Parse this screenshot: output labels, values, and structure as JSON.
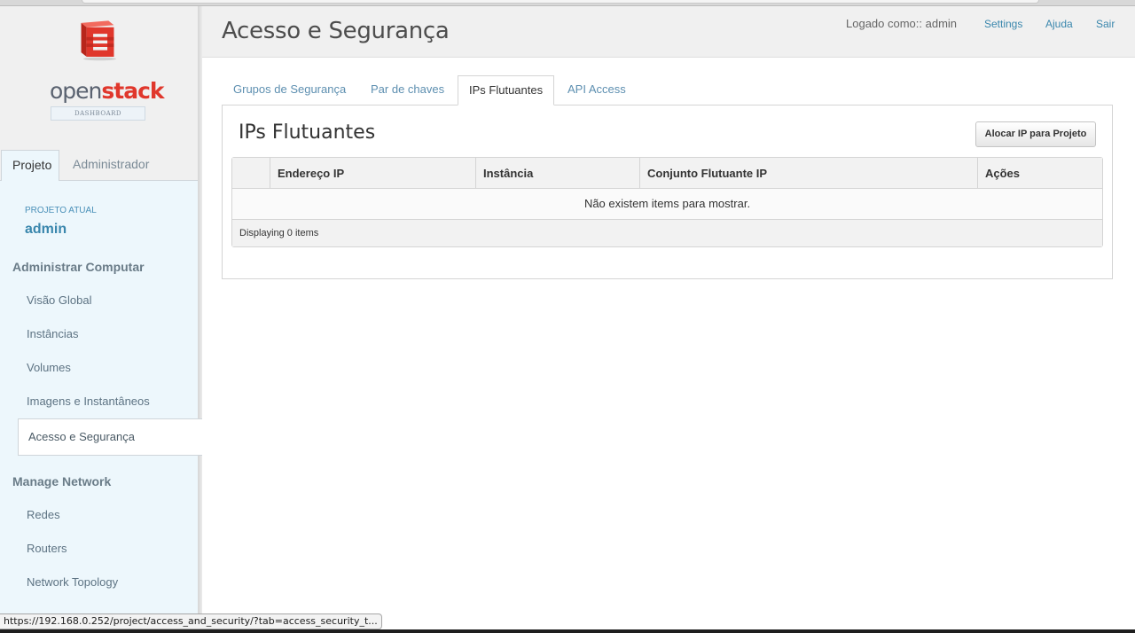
{
  "brand": {
    "open": "open",
    "stack": "stack",
    "badge": "DASHBOARD"
  },
  "sidebar": {
    "tabs": [
      {
        "label": "Projeto",
        "active": true
      },
      {
        "label": "Administrador",
        "active": false
      }
    ],
    "project_label": "PROJETO ATUAL",
    "project_name": "admin",
    "groups": [
      {
        "title": "Administrar Computar",
        "items": [
          {
            "label": "Visão Global"
          },
          {
            "label": "Instâncias"
          },
          {
            "label": "Volumes"
          },
          {
            "label": "Imagens e Instantâneos"
          },
          {
            "label": "Acesso e Segurança",
            "active": true
          }
        ]
      },
      {
        "title": "Manage Network",
        "items": [
          {
            "label": "Redes"
          },
          {
            "label": "Routers"
          },
          {
            "label": "Network Topology"
          }
        ]
      }
    ]
  },
  "header": {
    "title": "Acesso e Segurança",
    "logged_in": "Logado como:: admin",
    "links": {
      "settings": "Settings",
      "help": "Ajuda",
      "logout": "Sair"
    }
  },
  "tabs": [
    {
      "label": "Grupos de Segurança",
      "active": false
    },
    {
      "label": "Par de chaves",
      "active": false
    },
    {
      "label": "IPs Flutuantes",
      "active": true
    },
    {
      "label": "API Access",
      "active": false
    }
  ],
  "panel": {
    "title": "IPs Flutuantes",
    "allocate_button": "Alocar IP para Projeto"
  },
  "table": {
    "columns": [
      "",
      "Endereço IP",
      "Instância",
      "Conjunto Flutuante IP",
      "Ações"
    ],
    "empty_message": "Não existem items para mostrar.",
    "footer": "Displaying 0 items"
  },
  "status_bar": {
    "url": "https://192.168.0.252/project/access_and_security/?tab=access_security_t..."
  },
  "colors": {
    "brand_red": "#e0372c",
    "link_blue": "#3a87ad",
    "sidebar_panel": "#edf7fc"
  }
}
